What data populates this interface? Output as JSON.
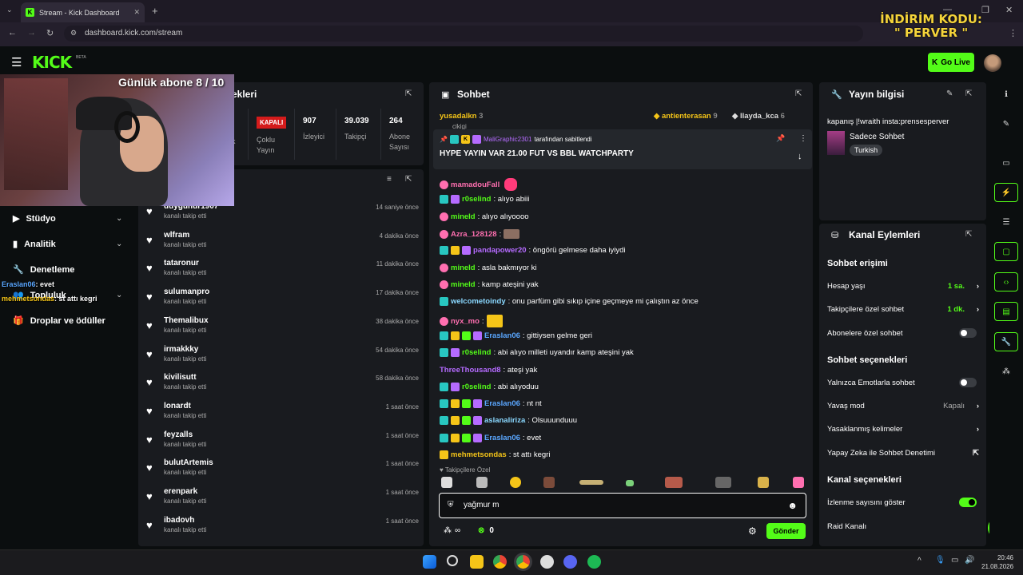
{
  "browser": {
    "tab_title": "Stream - Kick Dashboard",
    "url": "dashboard.kick.com/stream",
    "promo_line1": "İNDİRİM KODU:",
    "promo_line2": "\" PERVER \""
  },
  "header": {
    "logo": "KICK",
    "beta": "BETA",
    "go_live": "Go Live"
  },
  "webcam": {
    "overlay_text": "Günlük abone 8 / 10"
  },
  "sidebar": {
    "items": [
      {
        "label": "Stüdyo"
      },
      {
        "label": "Analitik"
      },
      {
        "label": "Denetleme"
      },
      {
        "label": "Topluluk"
      },
      {
        "label": "Droplar ve ödüller"
      }
    ],
    "overlay_chat": [
      {
        "user": "Eraslan06",
        "text": ": evet"
      },
      {
        "user": "mehmetsondas",
        "text": ": st attı kegri"
      }
    ]
  },
  "stats": {
    "title_fragment": "ekleri",
    "kapali": "KAPALI",
    "col0_label": "k",
    "multi_label": "Çoklu Yayın",
    "viewers_value": "907",
    "viewers_label": "İzleyici",
    "followers_value": "39.039",
    "followers_label": "Takipçi",
    "subs_value": "264",
    "subs_label": "Abone Sayısı"
  },
  "followers": {
    "rows": [
      {
        "name": "duygunur1907",
        "sub": "kanalı takip etti",
        "time": "14 saniye önce"
      },
      {
        "name": "wlfram",
        "sub": "kanalı takip etti",
        "time": "4 dakika önce"
      },
      {
        "name": "tataronur",
        "sub": "kanalı takip etti",
        "time": "11 dakika önce"
      },
      {
        "name": "sulumanpro",
        "sub": "kanalı takip etti",
        "time": "17 dakika önce"
      },
      {
        "name": "Themalibux",
        "sub": "kanalı takip etti",
        "time": "38 dakika önce"
      },
      {
        "name": "irmakkky",
        "sub": "kanalı takip etti",
        "time": "54 dakika önce"
      },
      {
        "name": "kivilisutt",
        "sub": "kanalı takip etti",
        "time": "58 dakika önce"
      },
      {
        "name": "lonardt",
        "sub": "kanalı takip etti",
        "time": "1 saat önce"
      },
      {
        "name": "feyzalls",
        "sub": "kanalı takip etti",
        "time": "1 saat önce"
      },
      {
        "name": "bulutArtemis",
        "sub": "kanalı takip etti",
        "time": "1 saat önce"
      },
      {
        "name": "erenpark",
        "sub": "kanalı takip etti",
        "time": "1 saat önce"
      },
      {
        "name": "ibadovh",
        "sub": "kanalı takip etti",
        "time": "1 saat önce"
      }
    ]
  },
  "chat": {
    "title": "Sohbet",
    "top_user_1": "yusadalkn",
    "top_user_1_count": "3",
    "top_user_2": "antienterasan",
    "top_user_2_count": "9",
    "top_user_3": "llayda_kca",
    "top_user_3_count": "6",
    "hidden_user": "cikigi",
    "pinned_by_user": "MaliGraphic2301",
    "pinned_by_suffix": "tarafından sabitlendi",
    "pinned_text": "HYPE YAYIN VAR 21.00 FUT VS BBL WATCHPARTY",
    "messages": [
      {
        "user": "mamadouFall",
        "color": "#ff6fb0",
        "text": ""
      },
      {
        "user": "r0selind",
        "color": "#53fc18",
        "text": ": alıyo abiii"
      },
      {
        "user": "mineld",
        "color": "#53fc18",
        "text": ": alıyo alıyoooo"
      },
      {
        "user": "Azra_128128",
        "color": "#ff6fb0",
        "text": ":"
      },
      {
        "user": "pandapower20",
        "color": "#b56bff",
        "text": ": öngörü gelmese daha iyiydi"
      },
      {
        "user": "mineld",
        "color": "#53fc18",
        "text": ": asla bakmıyor ki"
      },
      {
        "user": "mineld",
        "color": "#53fc18",
        "text": ": kamp ateşini yak"
      },
      {
        "user": "welcometoindy",
        "color": "#8ad8ff",
        "text": ": onu parfüm gibi sıkıp içine geçmeye mi çalıştın az önce"
      },
      {
        "user": "nyx_mo",
        "color": "#ff6fb0",
        "text": ":"
      },
      {
        "user": "Eraslan06",
        "color": "#5aa7ff",
        "text": ": gittiysen gelme geri"
      },
      {
        "user": "r0selind",
        "color": "#53fc18",
        "text": ": abi alıyo milleti uyandır kamp ateşini yak"
      },
      {
        "user": "ThreeThousand8",
        "color": "#b56bff",
        "text": ": ateşi yak"
      },
      {
        "user": "r0selind",
        "color": "#53fc18",
        "text": ": abi alıyoduu"
      },
      {
        "user": "Eraslan06",
        "color": "#5aa7ff",
        "text": ": nt nt"
      },
      {
        "user": "aslanaliriza",
        "color": "#8ad8ff",
        "text": ": Olsuuunduuu"
      },
      {
        "user": "Eraslan06",
        "color": "#5aa7ff",
        "text": ": evet"
      },
      {
        "user": "mehmetsondas",
        "color": "#f5c518",
        "text": ": st attı kegri"
      }
    ],
    "followers_only": "Takipçilere Özel",
    "input_value": "yağmur m",
    "infinity": "∞",
    "points": "0",
    "send": "Gönder"
  },
  "stream_info": {
    "title": "Yayın bilgisi",
    "stream_title": "kapanış |!wraith insta:prensesperver",
    "category": "Sadece Sohbet",
    "language": "Turkish"
  },
  "channel_actions": {
    "title": "Kanal Eylemleri",
    "chat_access": "Sohbet erişimi",
    "account_age_label": "Hesap yaşı",
    "account_age_value": "1 sa.",
    "followers_only_label": "Takipçilere özel sohbet",
    "followers_only_value": "1 dk.",
    "subs_only_label": "Abonelere özel sohbet",
    "chat_options": "Sohbet seçenekleri",
    "emote_only_label": "Yalnızca Emotlarla sohbet",
    "slow_mode_label": "Yavaş mod",
    "slow_mode_value": "Kapalı",
    "banned_words_label": "Yasaklanmış kelimeler",
    "ai_moderation_label": "Yapay Zeka ile Sohbet Denetimi",
    "channel_options": "Kanal seçenekleri",
    "show_viewers_label": "İzlenme sayısını göster",
    "raid_label": "Raid Kanalı"
  },
  "taskbar": {
    "time": "20:46",
    "date": "21.08.2026"
  },
  "colors": {
    "accent": "#53fc18",
    "panel": "#191b1f",
    "bg": "#0b0e0f",
    "danger": "#d41b1b"
  }
}
